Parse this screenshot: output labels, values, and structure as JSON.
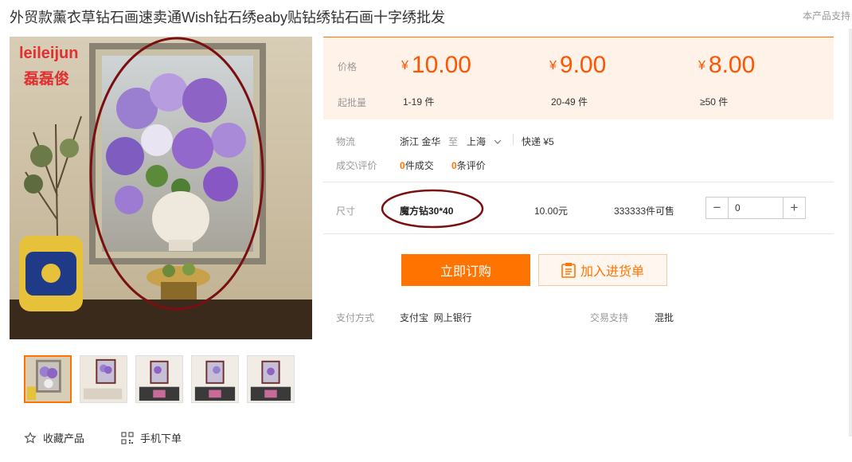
{
  "title": "外贸款薰衣草钻石画速卖通Wish钻石绣eaby贴钻绣钻石画十字绣批发",
  "support_text": "本产品支持",
  "image": {
    "watermark_en": "leileijun",
    "watermark_cn": "磊磊俊"
  },
  "price_panel": {
    "price_label": "价格",
    "batch_label": "起批量",
    "currency": "¥",
    "tiers": [
      {
        "price": "10.00",
        "qty": "1-19 件"
      },
      {
        "price": "9.00",
        "qty": "20-49 件"
      },
      {
        "price": "8.00",
        "qty": "≥50 件"
      }
    ]
  },
  "logistics": {
    "label": "物流",
    "from": "浙江 金华",
    "to_word": "至",
    "to": "上海",
    "express": "快递 ¥5"
  },
  "deals": {
    "label": "成交\\评价",
    "sold_count": "0",
    "sold_suffix": "件成交",
    "review_count": "0",
    "review_suffix": "条评价"
  },
  "sku": {
    "label": "尺寸",
    "name": "魔方钻30*40",
    "price": "10.00元",
    "stock": "333333件可售",
    "quantity": "0"
  },
  "buttons": {
    "buy": "立即订购",
    "cart": "加入进货单"
  },
  "payment": {
    "label": "支付方式",
    "methods": "支付宝  网上银行",
    "trade_label": "交易支持",
    "trade_value": "混批"
  },
  "actions": {
    "favorite": "收藏产品",
    "mobile": "手机下单"
  },
  "colors": {
    "accent": "#ff7300",
    "price": "#ff5500",
    "panel_bg": "#fff2e8",
    "annotation": "#7a0f12"
  },
  "icons": [
    "star-icon",
    "qr-code-icon",
    "chevron-down-icon",
    "clipboard-icon"
  ]
}
